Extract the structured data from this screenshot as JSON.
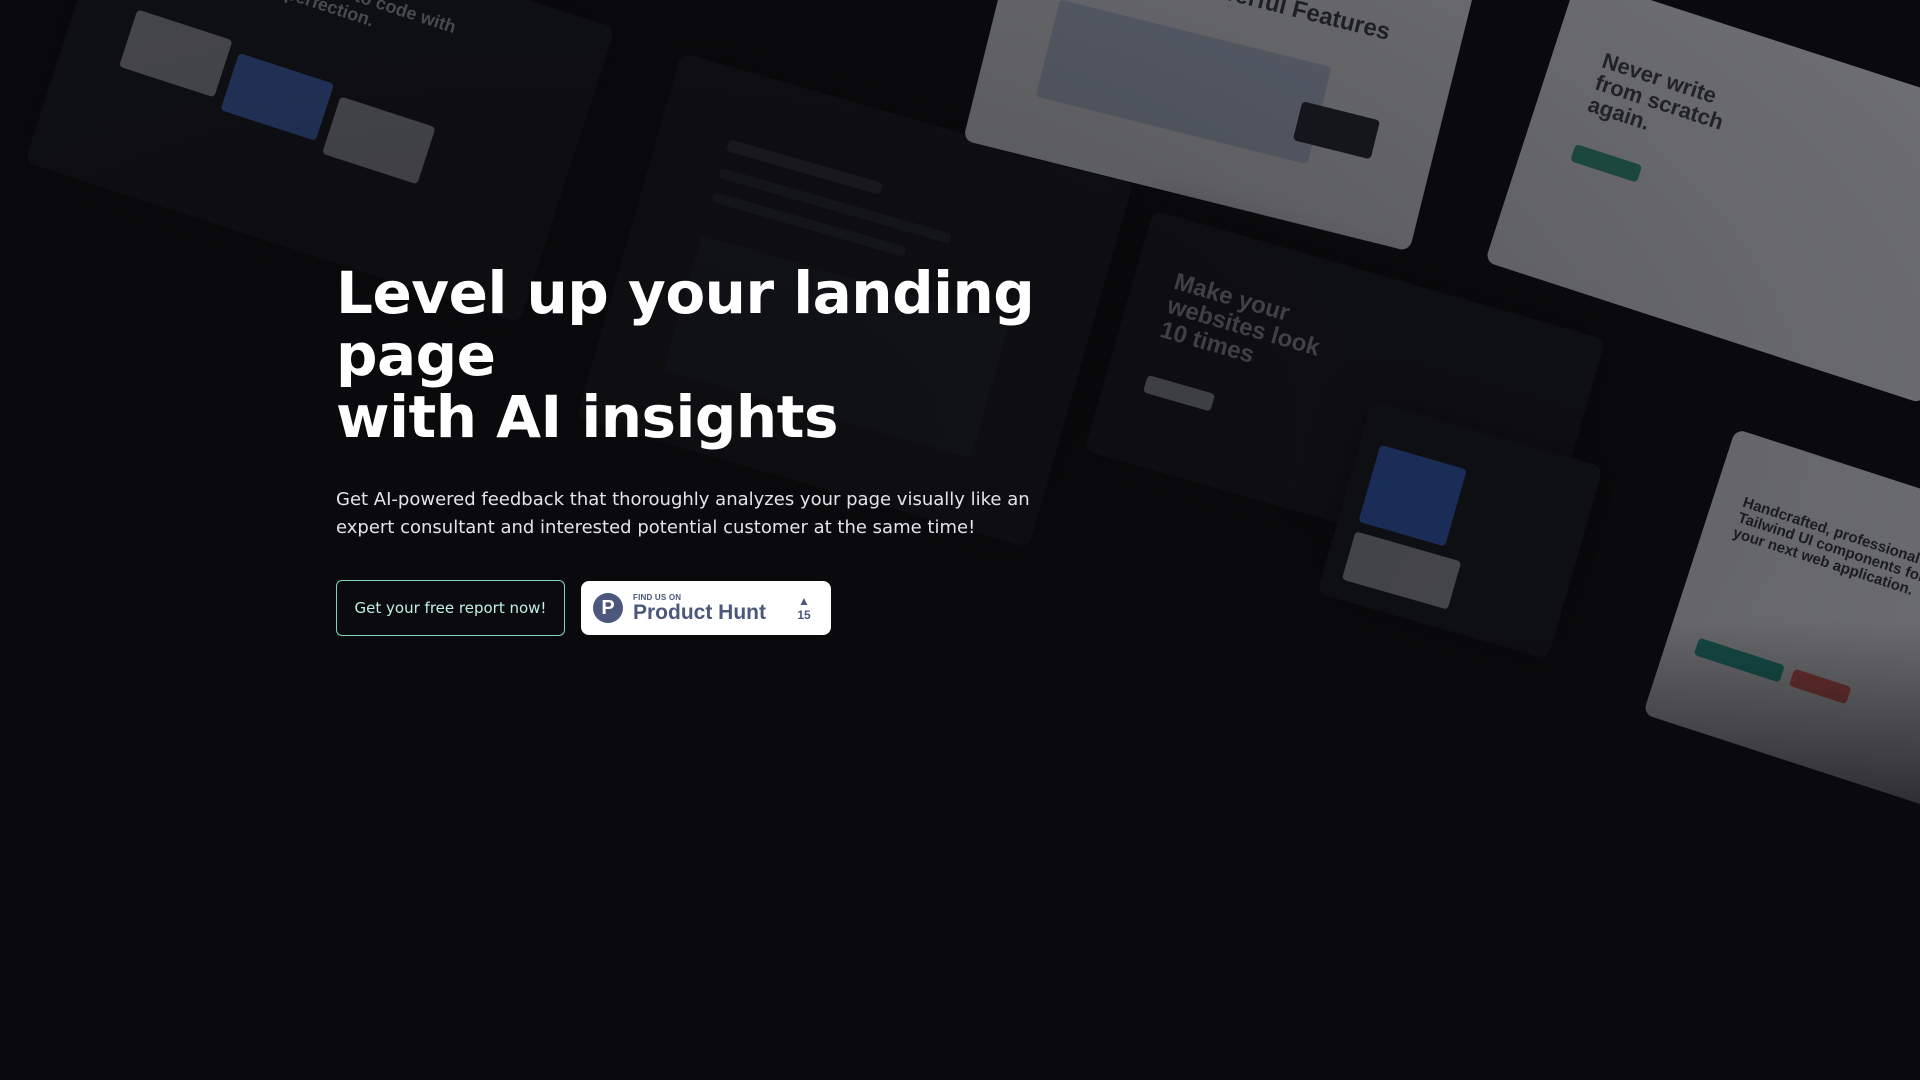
{
  "hero": {
    "title_line1": "Level up your landing page",
    "title_line2": "with AI insights",
    "subtitle_line1": "Get AI-powered feedback that thoroughly analyzes your page visually like an",
    "subtitle_line2": "expert consultant and interested potential customer at the same time!"
  },
  "cta": {
    "primary_label": "Get your free report now!"
  },
  "product_hunt": {
    "logo_letter": "P",
    "kicker": "FIND US ON",
    "name": "Product Hunt",
    "arrow": "▲",
    "votes": "15"
  },
  "background_collage": {
    "tile1_heading": "From design to code with\npixel perfection.",
    "tile2_heading": "Powerful Features",
    "tile3_heading": "Never write\nfrom scratch\nagain.",
    "tile4_heading": "Make your\nwebsites look\n10 times",
    "tile5_heading": "Handcrafted, professional\nTailwind UI components for\nyour next web application."
  },
  "colors": {
    "background": "#0a0a0c",
    "cta_border": "#7fd3c4",
    "cta_text": "#bff0e6",
    "product_hunt": "#4b587c"
  },
  "icons": {
    "product_hunt_logo": "product-hunt-logo-icon",
    "upvote": "upvote-arrow-icon"
  }
}
